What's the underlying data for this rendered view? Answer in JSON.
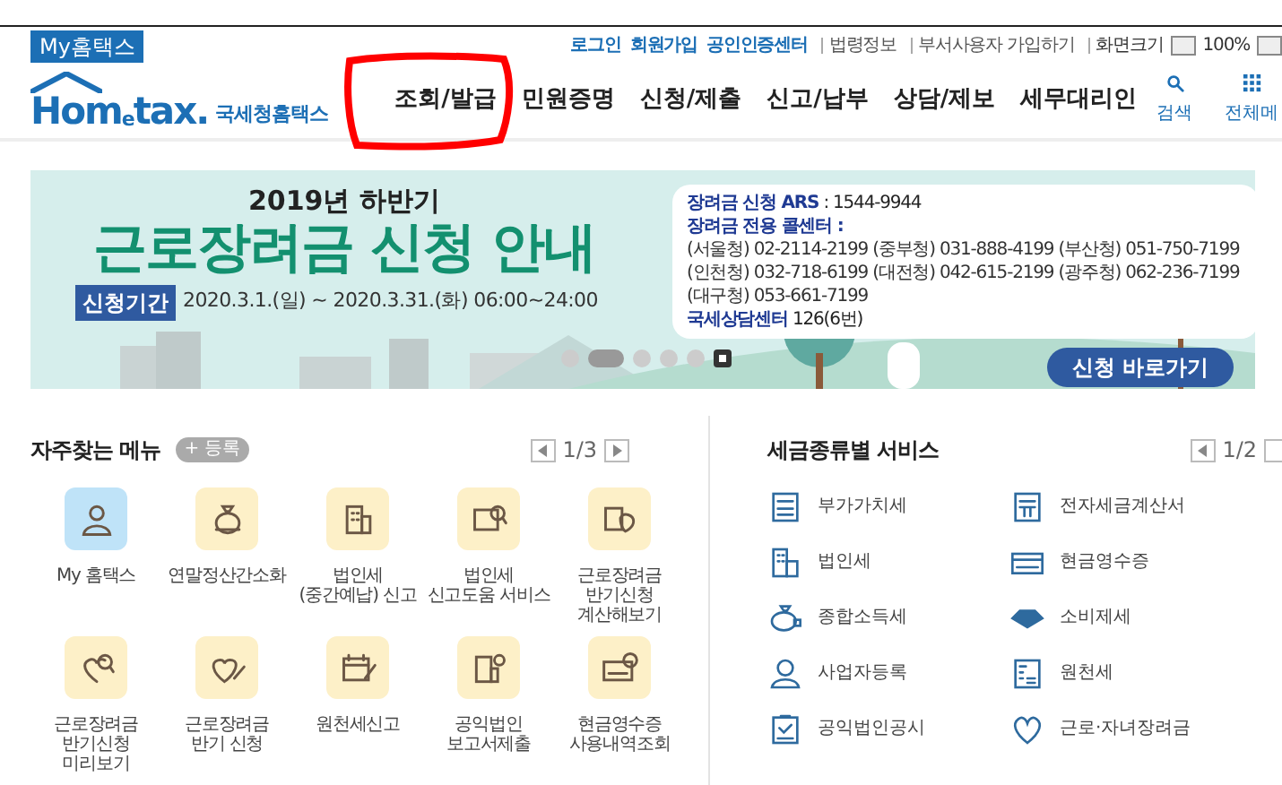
{
  "top_bar": {
    "my_hometax": "My홈택스",
    "links": [
      {
        "label": "로그인",
        "kind": "primary"
      },
      {
        "label": "회원가입",
        "kind": "primary"
      },
      {
        "label": "공인인증센터",
        "kind": "primary"
      },
      {
        "label": "법령정보",
        "kind": "plain"
      },
      {
        "label": "부서사용자 가입하기",
        "kind": "plain"
      }
    ],
    "screen_size": {
      "label": "화면크기",
      "zoom": "100%"
    }
  },
  "header": {
    "logo": {
      "brand": "Hom$_{e}$tax.",
      "subtitle": "국세청홈택스"
    },
    "nav": [
      {
        "label": "조회/발급",
        "circled": true
      },
      {
        "label": "민원증명",
        "circled": false
      },
      {
        "label": "신청/제출",
        "circled": false
      },
      {
        "label": "신고/납부",
        "circled": false
      },
      {
        "label": "상담/제보",
        "circled": false
      },
      {
        "label": "세무대리인",
        "circled": false
      }
    ],
    "tools": [
      {
        "label": "검색"
      },
      {
        "label": "전체메"
      }
    ]
  },
  "banner": {
    "subtitle": "2019년 하반기",
    "title": "근로장려금 신청 안내",
    "period_label": "신청기간",
    "period": "2020.3.1.(일) ~ 2020.3.31.(화) 06:00~24:00",
    "info": [
      {
        "kind": "heading",
        "label": "장려금 신청 ARS",
        "value": ": 1544-9944"
      },
      {
        "kind": "heading",
        "label": "장려금 전용 콜센터 :"
      },
      {
        "kind": "text",
        "label": "(서울청) 02-2114-2199 (중부청) 031-888-4199 (부산청) 051-750-7199"
      },
      {
        "kind": "text",
        "label": "(인천청) 032-718-6199 (대전청) 042-615-2199 (광주청) 062-236-7199"
      },
      {
        "kind": "text",
        "label": "(대구청) 053-661-7199"
      },
      {
        "kind": "heading",
        "label": "국세상담센터",
        "value": "126(6번)"
      }
    ],
    "slides": [
      {
        "selected": false
      },
      {
        "selected": true
      },
      {
        "selected": false
      },
      {
        "selected": false
      },
      {
        "selected": false
      }
    ],
    "cta": "신청 바로가기"
  },
  "favorites": {
    "title": "자주찾는 메뉴",
    "add": "+ 등록",
    "page": "1/3",
    "items": [
      {
        "label": "My 홈택스",
        "selected": true
      },
      {
        "label": "연말정산간소화",
        "selected": false
      },
      {
        "label": "법인세\n(중간예납) 신고",
        "selected": false
      },
      {
        "label": "법인세\n신고도움 서비스",
        "selected": false
      },
      {
        "label": "근로장려금\n반기신청\n계산해보기",
        "selected": false
      },
      {
        "label": "근로장려금\n반기신청\n미리보기",
        "selected": false
      },
      {
        "label": "근로장려금\n반기 신청",
        "selected": false
      },
      {
        "label": "원천세신고",
        "selected": false
      },
      {
        "label": "공익법인\n보고서제출",
        "selected": false
      },
      {
        "label": "현금영수증\n사용내역조회",
        "selected": false
      }
    ]
  },
  "tax_services": {
    "title": "세금종류별 서비스",
    "page": "1/2",
    "items": [
      {
        "label": "부가가치세"
      },
      {
        "label": "전자세금계산서"
      },
      {
        "label": "법인세"
      },
      {
        "label": "현금영수증"
      },
      {
        "label": "종합소득세"
      },
      {
        "label": "소비제세"
      },
      {
        "label": "사업자등록"
      },
      {
        "label": "원천세"
      },
      {
        "label": "공익법인공시"
      },
      {
        "label": "근로·자녀장려금"
      }
    ]
  }
}
